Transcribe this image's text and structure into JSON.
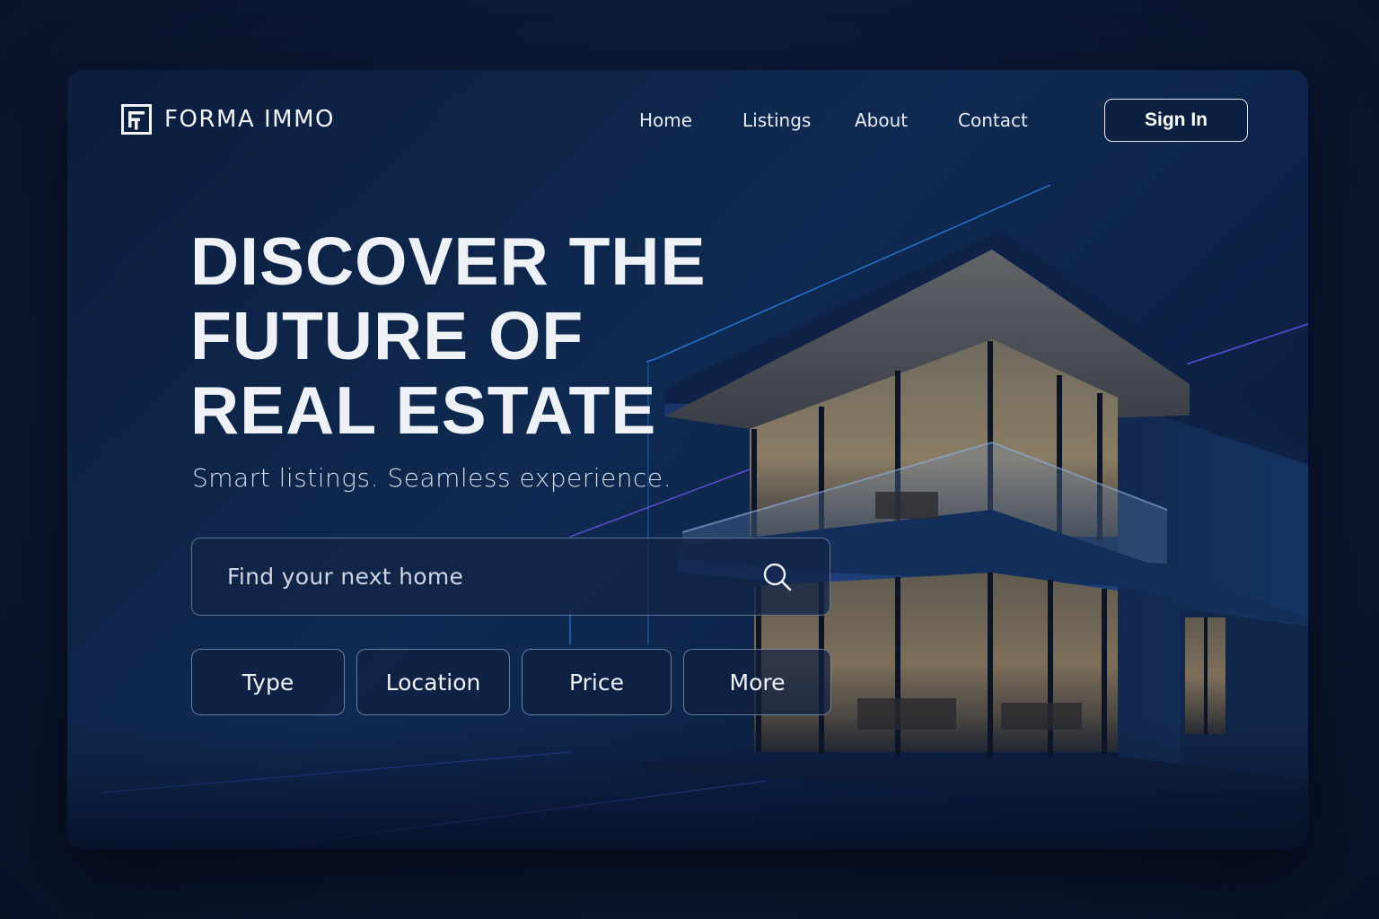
{
  "brand": {
    "name": "FORMA IMMO",
    "logo_icon": "forma-logo-icon"
  },
  "nav": {
    "items": [
      {
        "label": "Home"
      },
      {
        "label": "Listings"
      },
      {
        "label": "About"
      },
      {
        "label": "Contact"
      }
    ],
    "signin_label": "Sign In"
  },
  "hero": {
    "headline_lines": [
      "DISCOVER THE",
      "FUTURE OF",
      "REAL ESTATE"
    ],
    "subtitle": "Smart listings. Seamless experience."
  },
  "search": {
    "placeholder": "Find your next home",
    "value": "",
    "icon": "search-icon"
  },
  "filters": [
    {
      "label": "Type"
    },
    {
      "label": "Location"
    },
    {
      "label": "Price"
    },
    {
      "label": "More"
    }
  ],
  "colors": {
    "background": "#0b1733",
    "accent_blue": "#2f8cff",
    "accent_purple": "#7b5cff",
    "text": "#eef1f6",
    "window_glow": "#c9b48e"
  }
}
